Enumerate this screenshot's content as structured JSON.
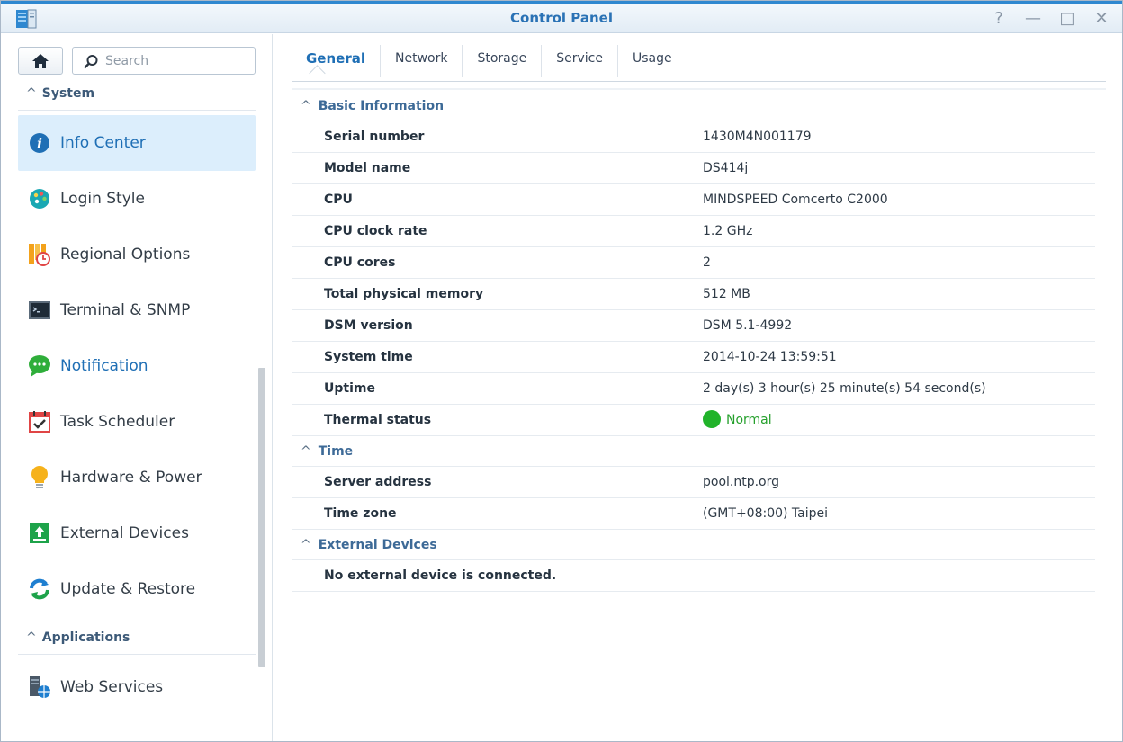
{
  "window": {
    "title": "Control Panel",
    "controls": {
      "help": "?",
      "minimize": "—",
      "maximize": "□",
      "close": "✕"
    }
  },
  "sidebar": {
    "search": {
      "placeholder": "Search",
      "value": ""
    },
    "sections": [
      {
        "label": "System"
      },
      {
        "label": "Applications"
      }
    ],
    "items": [
      {
        "label": "Info Center",
        "icon": "info-icon",
        "active": true
      },
      {
        "label": "Login Style",
        "icon": "palette-icon"
      },
      {
        "label": "Regional Options",
        "icon": "calendar-clock-icon"
      },
      {
        "label": "Terminal & SNMP",
        "icon": "terminal-icon"
      },
      {
        "label": "Notification",
        "icon": "chat-bubble-icon"
      },
      {
        "label": "Task Scheduler",
        "icon": "calendar-check-icon"
      },
      {
        "label": "Hardware & Power",
        "icon": "lightbulb-icon"
      },
      {
        "label": "External Devices",
        "icon": "upload-icon"
      },
      {
        "label": "Update & Restore",
        "icon": "refresh-icon"
      },
      {
        "label": "Web Services",
        "icon": "web-services-icon"
      }
    ]
  },
  "tabs": [
    "General",
    "Network",
    "Storage",
    "Service",
    "Usage"
  ],
  "info": {
    "basic": {
      "title": "Basic Information",
      "rows": [
        {
          "key": "Serial number",
          "value": "1430M4N001179"
        },
        {
          "key": "Model name",
          "value": "DS414j"
        },
        {
          "key": "CPU",
          "value": "MINDSPEED Comcerto C2000"
        },
        {
          "key": "CPU clock rate",
          "value": "1.2 GHz"
        },
        {
          "key": "CPU cores",
          "value": "2"
        },
        {
          "key": "Total physical memory",
          "value": "512 MB"
        },
        {
          "key": "DSM version",
          "value": "DSM 5.1-4992"
        },
        {
          "key": "System time",
          "value": "2014-10-24 13:59:51"
        },
        {
          "key": "Uptime",
          "value": "2 day(s) 3 hour(s) 25 minute(s) 54 second(s)"
        },
        {
          "key": "Thermal status",
          "value": "Normal"
        }
      ]
    },
    "time": {
      "title": "Time",
      "rows": [
        {
          "key": "Server address",
          "value": "pool.ntp.org"
        },
        {
          "key": "Time zone",
          "value": "(GMT+08:00) Taipei"
        }
      ]
    },
    "external": {
      "title": "External Devices",
      "message": "No external device is connected."
    }
  },
  "colors": {
    "accent": "#1f6fb5",
    "active_bg": "#dceefc",
    "status_ok": "#21b32a"
  }
}
